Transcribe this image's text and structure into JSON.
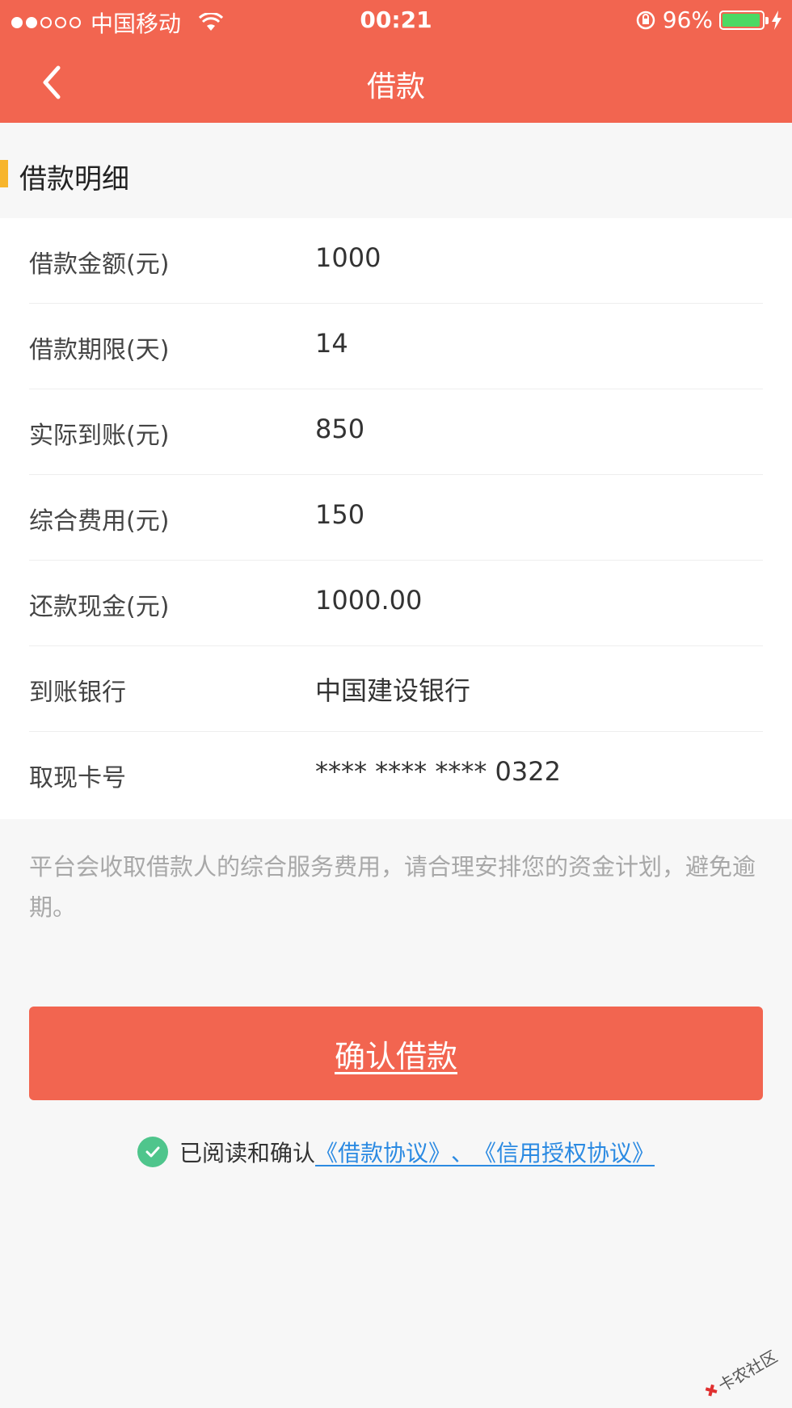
{
  "status_bar": {
    "carrier": "中国移动",
    "time": "00:21",
    "battery": "96%",
    "battery_level": 0.96
  },
  "navbar": {
    "title": "借款",
    "back_icon": "chevron-left-icon"
  },
  "section": {
    "title": "借款明细"
  },
  "details": [
    {
      "label": "借款金额(元)",
      "value": "1000"
    },
    {
      "label": "借款期限(天)",
      "value": "14"
    },
    {
      "label": "实际到账(元)",
      "value": "850"
    },
    {
      "label": "综合费用(元)",
      "value": "150"
    },
    {
      "label": "还款现金(元)",
      "value": "1000.00"
    },
    {
      "label": "到账银行",
      "value": "中国建设银行"
    },
    {
      "label": "取现卡号",
      "value": "**** **** **** 0322"
    }
  ],
  "notice": "平台会收取借款人的综合服务费用，请合理安排您的资金计划，避免逾期。",
  "confirm_button": "确认借款",
  "agreement": {
    "prefix": "已阅读和确认",
    "loan_agreement": "《借款协议》",
    "separator": "、",
    "credit_agreement": "《信用授权协议》"
  },
  "watermark": "卡农社区",
  "colors": {
    "primary": "#f26550",
    "accent_bar": "#f7b52c",
    "check": "#4fc58c",
    "link": "#2b8ae2"
  }
}
